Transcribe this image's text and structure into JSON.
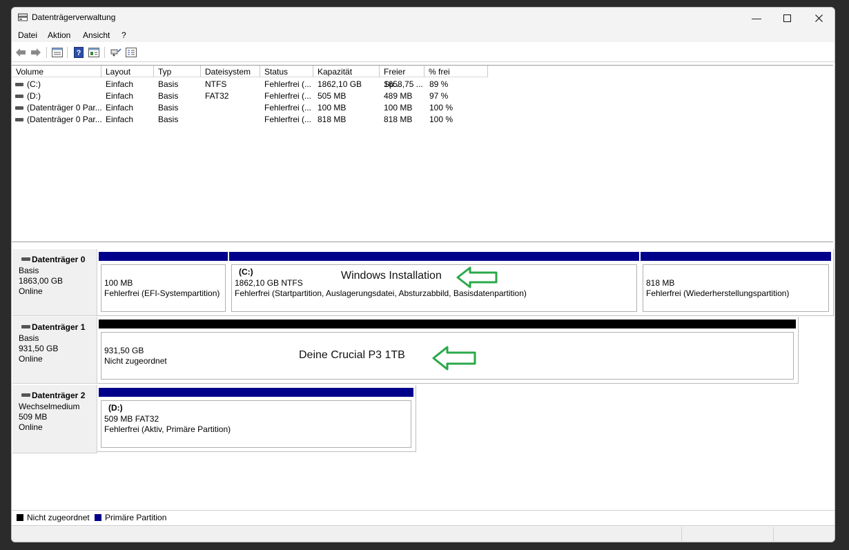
{
  "window": {
    "title": "Datenträgerverwaltung"
  },
  "menu": [
    "Datei",
    "Aktion",
    "Ansicht",
    "?"
  ],
  "toolbar_icons": [
    "back-arrow-icon",
    "forward-arrow-icon",
    "disk-list-icon",
    "help-icon",
    "properties-icon",
    "refresh-icon",
    "settings-icon"
  ],
  "columns": [
    "Volume",
    "Layout",
    "Typ",
    "Dateisystem",
    "Status",
    "Kapazität",
    "Freier Sp...",
    "% frei"
  ],
  "volumes": [
    [
      "(C:)",
      "Einfach",
      "Basis",
      "NTFS",
      "Fehlerfrei (...",
      "1862,10 GB",
      "1658,75 ...",
      "89 %"
    ],
    [
      "(D:)",
      "Einfach",
      "Basis",
      "FAT32",
      "Fehlerfrei (...",
      "505 MB",
      "489 MB",
      "97 %"
    ],
    [
      "(Datenträger 0 Par...",
      "Einfach",
      "Basis",
      "",
      "Fehlerfrei (...",
      "100 MB",
      "100 MB",
      "100 %"
    ],
    [
      "(Datenträger 0 Par...",
      "Einfach",
      "Basis",
      "",
      "Fehlerfrei (...",
      "818 MB",
      "818 MB",
      "100 %"
    ]
  ],
  "disks": [
    {
      "name": "Datenträger 0",
      "type": "Basis",
      "size": "1863,00 GB",
      "state": "Online",
      "partitions": [
        {
          "label": "",
          "line1": "100 MB",
          "line2": "Fehlerfrei (EFI-Systempartition)",
          "kind": "primary"
        },
        {
          "label": "(C:)",
          "line1": "1862,10 GB NTFS",
          "line2": "Fehlerfrei (Startpartition, Auslagerungsdatei, Absturzabbild, Basisdatenpartition)",
          "kind": "primary"
        },
        {
          "label": "",
          "line1": "818 MB",
          "line2": "Fehlerfrei (Wiederherstellungspartition)",
          "kind": "primary"
        }
      ]
    },
    {
      "name": "Datenträger 1",
      "type": "Basis",
      "size": "931,50 GB",
      "state": "Online",
      "partitions": [
        {
          "label": "",
          "line1": "931,50 GB",
          "line2": "Nicht zugeordnet",
          "kind": "unallocated"
        }
      ]
    },
    {
      "name": "Datenträger 2",
      "type": "Wechselmedium",
      "size": "509 MB",
      "state": "Online",
      "partitions": [
        {
          "label": "(D:)",
          "line1": "509 MB FAT32",
          "line2": "Fehlerfrei (Aktiv, Primäre Partition)",
          "kind": "primary"
        }
      ]
    }
  ],
  "annotations": {
    "windows_install": "Windows Installation",
    "crucial": "Deine Crucial P3  1TB"
  },
  "legend": {
    "unallocated": "Nicht zugeordnet",
    "primary": "Primäre Partition"
  },
  "colors": {
    "primary": "#00008b",
    "unallocated": "#000000",
    "arrow": "#2aa84a"
  }
}
